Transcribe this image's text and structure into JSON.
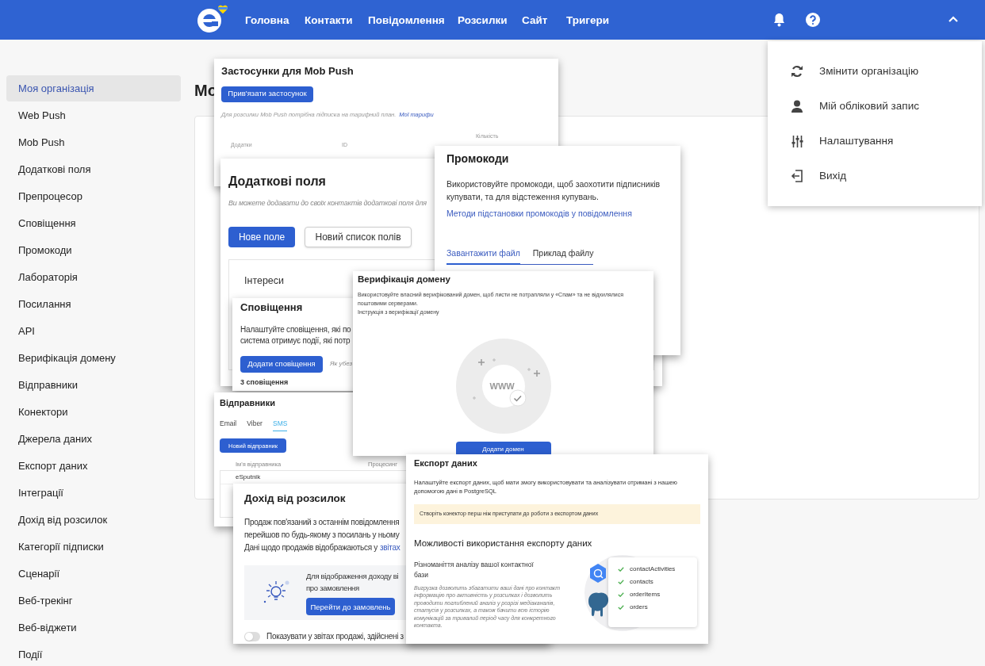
{
  "header": {
    "nav": [
      "Головна",
      "Контакти",
      "Повідомлення",
      "Розсилки",
      "Сайт",
      "Тригери"
    ]
  },
  "sidebar": {
    "items": [
      {
        "label": "Моя організація",
        "selected": true
      },
      {
        "label": "Web Push",
        "selected": false
      },
      {
        "label": "Mob Push",
        "selected": false
      },
      {
        "label": "Додаткові поля",
        "selected": false
      },
      {
        "label": "Препроцесор",
        "selected": false
      },
      {
        "label": "Сповіщення",
        "selected": false
      },
      {
        "label": "Промокоди",
        "selected": false
      },
      {
        "label": "Лабораторія",
        "selected": false
      },
      {
        "label": "Посилання",
        "selected": false
      },
      {
        "label": "API",
        "selected": false
      },
      {
        "label": "Верифікація домену",
        "selected": false
      },
      {
        "label": "Відправники",
        "selected": false
      },
      {
        "label": "Конектори",
        "selected": false
      },
      {
        "label": "Джерела даних",
        "selected": false
      },
      {
        "label": "Експорт даних",
        "selected": false
      },
      {
        "label": "Інтеграції",
        "selected": false
      },
      {
        "label": "Дохід від розсилок",
        "selected": false
      },
      {
        "label": "Категорії підписки",
        "selected": false
      },
      {
        "label": "Сценарії",
        "selected": false
      },
      {
        "label": "Веб-трекінг",
        "selected": false
      },
      {
        "label": "Веб-віджети",
        "selected": false
      },
      {
        "label": "Події",
        "selected": false
      }
    ]
  },
  "page_title": "Мо",
  "user_menu": {
    "items": [
      "Змінити організацію",
      "Мій обліковий запис",
      "Налаштування",
      "Вихід"
    ]
  },
  "cards": [
    {
      "kind": "mob_push",
      "title": "Застосунки для Mob Push",
      "button": "Прив'язати застосунок",
      "note": "Для розсилки Mob Push потрібна підписка на тарифний план.",
      "link": "Мої тарифи",
      "columns": [
        "Додатки",
        "ID",
        "Кількість"
      ]
    },
    {
      "kind": "custom_fields",
      "title": "Додаткові поля",
      "subtitle": "Ви можете додавати до своїх контактів додаткові поля для",
      "buttons": [
        "Нове поле",
        "Новий список полів"
      ],
      "group": "Інтереси"
    },
    {
      "kind": "promo",
      "title": "Промокоди",
      "text": "Використовуйте промокоди, щоб заохотити підписників купувати, та для відстеження купувань.",
      "link": "Методи підстановки промокодів у повідомлення",
      "tabs": [
        {
          "label": "Завантажити файл",
          "selected": true
        },
        {
          "label": "Приклад файлу",
          "selected": false
        }
      ]
    },
    {
      "kind": "notifications",
      "title": "Сповіщення",
      "text_lines": [
        "Налаштуйте сповіщення, які по",
        "система отримує події, які потр"
      ],
      "button": "Додати сповіщення",
      "hint": "Як убез",
      "count": "3 сповіщення"
    },
    {
      "kind": "senders",
      "title": "Відправники",
      "tabs": [
        {
          "label": "Email",
          "selected": false
        },
        {
          "label": "Viber",
          "selected": false
        },
        {
          "label": "SMS",
          "selected": true
        }
      ],
      "button": "Новий відправник",
      "columns": [
        "Ім'я відправника",
        "Процесинг"
      ],
      "rows": [
        "eSputnik"
      ]
    },
    {
      "kind": "domain",
      "title": "Верифікація домену",
      "text_lines": [
        "Використовуйте власний верифікований домен, щоб листи не потрапляли у «Спам» та не відхилялися",
        "поштовими серверами."
      ],
      "link": "Інструкція з верифікації домену",
      "illustration_label": "WWW",
      "button": "Додати домен"
    },
    {
      "kind": "revenue",
      "title": "Дохід від розсилок",
      "text_lines": [
        "Продаж пов'язаний з останнім повідомлення",
        "перейшов по будь-якому з посилань у ньому",
        "Дані щодо продажів відображаються у"
      ],
      "link": "звітах",
      "panel_lines": [
        "Для відображення доходу ві",
        "про замовлення"
      ],
      "button": "Перейти до замовлень",
      "toggle": {
        "label": "Показувати у звітах продажі, здійснені з",
        "on": false
      }
    },
    {
      "kind": "export",
      "title": "Експорт даних",
      "text": "Налаштуйте експорт даних, щоб мати змогу використовувати та аналізувати отримані з нашею допомогою дані в PostgreSQL",
      "notice": "Створіть конектор перш ніж приступати до роботи з експортом даних",
      "subheading": "Можливості використання експорту даних",
      "feature_title": "Різноманіття аналізу вашої контактної бази",
      "feature_text": "Вигрузка дозволить збагатити ваші дані про контакт інформацію про активність у розсилках і дозволить проводити поглиблений аналіз у розрізі медіаканалів, статусів у розсилках, а також бачити всю історію комунікацій за тривалий період часу для конкретного контакта.",
      "tables": [
        "contactActivities",
        "contacts",
        "orderItems",
        "orders"
      ]
    }
  ]
}
